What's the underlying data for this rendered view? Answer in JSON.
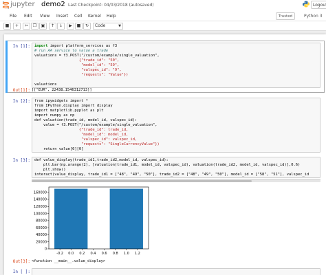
{
  "header": {
    "logo_text": "jupyter",
    "notebook_name": "demo2",
    "checkpoint": "Last Checkpoint: 04/03/2018 (autosaved)",
    "logout": "Logout"
  },
  "menu": {
    "items": [
      "File",
      "Edit",
      "View",
      "Insert",
      "Cell",
      "Kernel",
      "Help"
    ],
    "trusted": "Trusted",
    "kernel": "Python 3"
  },
  "toolbar": {
    "cell_type": "Code",
    "buttons": [
      "save-icon",
      "plus-icon",
      "cut-icon",
      "copy-icon",
      "paste-icon",
      "arrow-up-icon",
      "arrow-down-icon",
      "run-icon",
      "stop-icon",
      "restart-icon"
    ]
  },
  "cells": [
    {
      "prompt": "In [1]:",
      "lines": [
        "import platform_services as f3",
        "# run AA service to value a trade",
        "valuations = f3.POST(\"/custom/example/single_valuation\",",
        "                    {\"trade_id\": \"50\",",
        "                     \"model_id\": \"59\",",
        "                     \"valspec_id\": \"9\",",
        "                     \"requests\": \"Value\"})",
        "",
        "valuations"
      ],
      "out_prompt": "Out[1]:",
      "output": "[[\"EUR\", 22438.1546312713]]"
    },
    {
      "prompt": "In [2]:",
      "lines": [
        "from ipywidgets import *",
        "from IPython.display import display",
        "import matplotlib.pyplot as plt",
        "import numpy as np",
        "def valuation(trade_id, model_id, valspec_id):",
        "    value = f3.POST(\"/custom/example/single_valuation\",",
        "                    {\"trade_id\": trade_id,",
        "                     \"model_id\": model_id,",
        "                     \"valspec_id\": valspec_id,",
        "                     \"requests\": \"SingleCurrencyValue\"})",
        "    return value[0][0]"
      ]
    },
    {
      "prompt": "In [3]:",
      "lines": [
        "def value_display(trade_id1,trade_id2,model_id, valspec_id):",
        "    plt.bar(np.arange(2), [valuation(trade_id1, model_id, valspec_id), valuation(trade_id2, model_id, valspec_id)],0.6)",
        "    plt.show()",
        "interact(value_display, trade_id1 = [\"48\", \"49\", \"50\"], trade_id2 = [\"48\", \"49\", \"50\"], model_id = [\"58\", \"51\"], valspec_id"
      ],
      "out_prompt": "Out[3]:",
      "output": "<function __main__.value_display>"
    },
    {
      "prompt": "In [ ]:"
    }
  ],
  "chart_data": {
    "type": "bar",
    "x": [
      0,
      1
    ],
    "values": [
      170000,
      170000
    ],
    "bar_width": 0.6,
    "color": "#1f77b4",
    "xlim": [
      -0.4,
      1.4
    ],
    "ylim": [
      0,
      175000
    ],
    "xticks": [
      "-0.2",
      "0.0",
      "0.2",
      "0.4",
      "0.6",
      "0.8",
      "1.0",
      "1.2"
    ],
    "yticks": [
      "0",
      "20000",
      "40000",
      "60000",
      "80000",
      "100000",
      "120000",
      "140000",
      "160000"
    ],
    "title": "",
    "xlabel": "",
    "ylabel": ""
  }
}
